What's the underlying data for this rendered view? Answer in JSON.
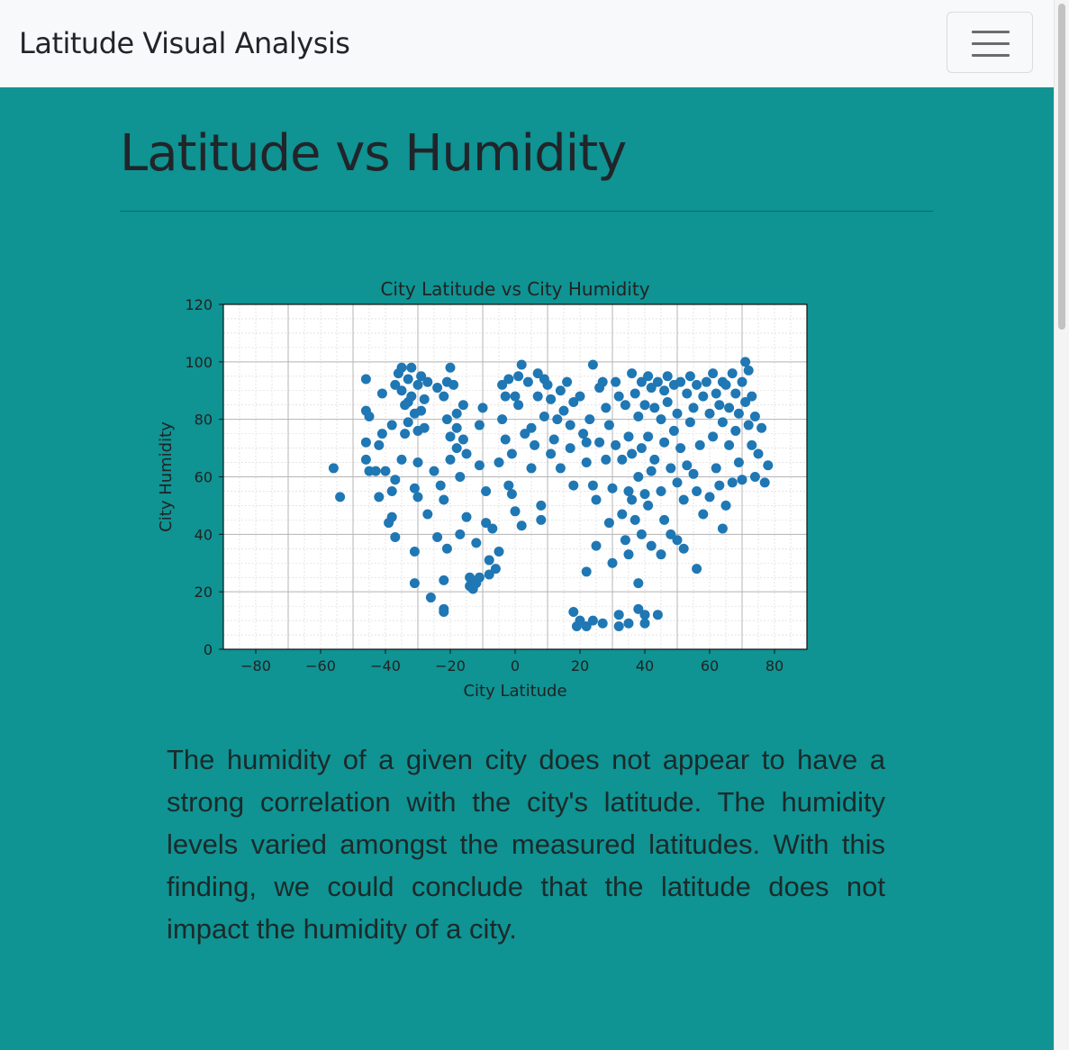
{
  "navbar": {
    "brand": "Latitude Visual Analysis",
    "toggler_icon": "hamburger-menu-icon"
  },
  "main": {
    "title": "Latitude vs Humidity",
    "description": "The humidity of a given city does not appear to have a strong correlation with the city's latitude. The humidity levels varied amongst the measured latitudes. With this finding, we could conclude that the latitude does not impact the humidity of a city."
  },
  "colors": {
    "background": "#0f9393",
    "navbar": "#f8f9fa",
    "point": "#1f77b4"
  },
  "chart_data": {
    "type": "scatter",
    "title": "City Latitude vs City Humidity",
    "xlabel": "City Latitude",
    "ylabel": "City Humidity",
    "xlim": [
      -90,
      90
    ],
    "ylim": [
      0,
      120
    ],
    "xticks": [
      -80,
      -60,
      -40,
      -20,
      0,
      20,
      40,
      60,
      80
    ],
    "yticks": [
      0,
      20,
      40,
      60,
      80,
      100,
      120
    ],
    "x_tick_labels": [
      "−80",
      "−60",
      "−40",
      "−20",
      "0",
      "20",
      "40",
      "60",
      "80"
    ],
    "y_tick_labels": [
      "0",
      "20",
      "40",
      "60",
      "80",
      "100",
      "120"
    ],
    "grid": true,
    "series": [
      {
        "points": [
          [
            -56,
            63
          ],
          [
            -54,
            53
          ],
          [
            -46,
            94
          ],
          [
            -46,
            83
          ],
          [
            -45,
            81
          ],
          [
            -46,
            72
          ],
          [
            -46,
            66
          ],
          [
            -45,
            62
          ],
          [
            -43,
            62
          ],
          [
            -42,
            53
          ],
          [
            -42,
            71
          ],
          [
            -41,
            75
          ],
          [
            -41,
            89
          ],
          [
            -40,
            62
          ],
          [
            -39,
            44
          ],
          [
            -38,
            46
          ],
          [
            -37,
            39
          ],
          [
            -37,
            59
          ],
          [
            -38,
            55
          ],
          [
            -38,
            78
          ],
          [
            -37,
            92
          ],
          [
            -36,
            96
          ],
          [
            -35,
            98
          ],
          [
            -35,
            90
          ],
          [
            -34,
            85
          ],
          [
            -33,
            94
          ],
          [
            -33,
            79
          ],
          [
            -34,
            75
          ],
          [
            -35,
            66
          ],
          [
            -33,
            86
          ],
          [
            -32,
            98
          ],
          [
            -32,
            88
          ],
          [
            -31,
            82
          ],
          [
            -30,
            92
          ],
          [
            -30,
            76
          ],
          [
            -30,
            65
          ],
          [
            -29,
            95
          ],
          [
            -29,
            83
          ],
          [
            -28,
            87
          ],
          [
            -28,
            77
          ],
          [
            -27,
            93
          ],
          [
            -31,
            56
          ],
          [
            -30,
            53
          ],
          [
            -31,
            34
          ],
          [
            -31,
            23
          ],
          [
            -27,
            47
          ],
          [
            -26,
            18
          ],
          [
            -25,
            62
          ],
          [
            -24,
            39
          ],
          [
            -23,
            57
          ],
          [
            -22,
            52
          ],
          [
            -22,
            14
          ],
          [
            -22,
            13
          ],
          [
            -22,
            24
          ],
          [
            -21,
            35
          ],
          [
            -24,
            91
          ],
          [
            -22,
            88
          ],
          [
            -21,
            93
          ],
          [
            -20,
            98
          ],
          [
            -21,
            80
          ],
          [
            -20,
            74
          ],
          [
            -20,
            66
          ],
          [
            -19,
            92
          ],
          [
            -18,
            82
          ],
          [
            -18,
            77
          ],
          [
            -18,
            70
          ],
          [
            -17,
            60
          ],
          [
            -17,
            40
          ],
          [
            -16,
            85
          ],
          [
            -16,
            73
          ],
          [
            -15,
            68
          ],
          [
            -15,
            46
          ],
          [
            -14,
            22
          ],
          [
            -14,
            25
          ],
          [
            -13,
            21
          ],
          [
            -12,
            23
          ],
          [
            -12,
            37
          ],
          [
            -11,
            25
          ],
          [
            -11,
            64
          ],
          [
            -11,
            78
          ],
          [
            -10,
            84
          ],
          [
            -9,
            55
          ],
          [
            -9,
            44
          ],
          [
            -8,
            31
          ],
          [
            -8,
            26
          ],
          [
            -7,
            42
          ],
          [
            -6,
            28
          ],
          [
            -5,
            34
          ],
          [
            -5,
            65
          ],
          [
            -4,
            92
          ],
          [
            -4,
            80
          ],
          [
            -3,
            88
          ],
          [
            -3,
            73
          ],
          [
            -2,
            94
          ],
          [
            -2,
            57
          ],
          [
            -1,
            54
          ],
          [
            -1,
            68
          ],
          [
            0,
            88
          ],
          [
            0,
            48
          ],
          [
            1,
            95
          ],
          [
            2,
            99
          ],
          [
            1,
            85
          ],
          [
            2,
            43
          ],
          [
            3,
            75
          ],
          [
            4,
            93
          ],
          [
            5,
            77
          ],
          [
            5,
            63
          ],
          [
            6,
            71
          ],
          [
            7,
            96
          ],
          [
            7,
            88
          ],
          [
            8,
            50
          ],
          [
            8,
            45
          ],
          [
            9,
            81
          ],
          [
            9,
            94
          ],
          [
            10,
            92
          ],
          [
            11,
            87
          ],
          [
            11,
            68
          ],
          [
            12,
            73
          ],
          [
            13,
            80
          ],
          [
            14,
            90
          ],
          [
            14,
            63
          ],
          [
            15,
            83
          ],
          [
            16,
            93
          ],
          [
            17,
            70
          ],
          [
            17,
            78
          ],
          [
            18,
            86
          ],
          [
            18,
            57
          ],
          [
            18,
            13
          ],
          [
            19,
            8
          ],
          [
            20,
            10
          ],
          [
            20,
            88
          ],
          [
            21,
            75
          ],
          [
            22,
            72
          ],
          [
            22,
            65
          ],
          [
            22,
            27
          ],
          [
            22,
            8
          ],
          [
            23,
            80
          ],
          [
            24,
            99
          ],
          [
            24,
            10
          ],
          [
            24,
            57
          ],
          [
            25,
            36
          ],
          [
            25,
            52
          ],
          [
            26,
            72
          ],
          [
            26,
            91
          ],
          [
            27,
            93
          ],
          [
            27,
            9
          ],
          [
            28,
            84
          ],
          [
            28,
            66
          ],
          [
            29,
            78
          ],
          [
            29,
            44
          ],
          [
            30,
            30
          ],
          [
            30,
            56
          ],
          [
            31,
            93
          ],
          [
            31,
            71
          ],
          [
            32,
            88
          ],
          [
            32,
            8
          ],
          [
            32,
            12
          ],
          [
            33,
            66
          ],
          [
            33,
            47
          ],
          [
            34,
            38
          ],
          [
            34,
            85
          ],
          [
            35,
            55
          ],
          [
            35,
            33
          ],
          [
            35,
            74
          ],
          [
            35,
            9
          ],
          [
            36,
            96
          ],
          [
            36,
            68
          ],
          [
            36,
            52
          ],
          [
            37,
            89
          ],
          [
            37,
            45
          ],
          [
            38,
            81
          ],
          [
            38,
            60
          ],
          [
            38,
            23
          ],
          [
            38,
            14
          ],
          [
            39,
            93
          ],
          [
            39,
            70
          ],
          [
            39,
            40
          ],
          [
            40,
            85
          ],
          [
            40,
            54
          ],
          [
            40,
            12
          ],
          [
            40,
            9
          ],
          [
            41,
            95
          ],
          [
            41,
            74
          ],
          [
            41,
            50
          ],
          [
            42,
            91
          ],
          [
            42,
            62
          ],
          [
            42,
            36
          ],
          [
            43,
            84
          ],
          [
            43,
            66
          ],
          [
            44,
            93
          ],
          [
            44,
            12
          ],
          [
            45,
            80
          ],
          [
            45,
            55
          ],
          [
            45,
            33
          ],
          [
            46,
            90
          ],
          [
            46,
            72
          ],
          [
            46,
            45
          ],
          [
            47,
            95
          ],
          [
            47,
            86
          ],
          [
            48,
            63
          ],
          [
            48,
            40
          ],
          [
            49,
            92
          ],
          [
            49,
            76
          ],
          [
            50,
            82
          ],
          [
            50,
            58
          ],
          [
            50,
            38
          ],
          [
            51,
            93
          ],
          [
            51,
            70
          ],
          [
            52,
            52
          ],
          [
            52,
            35
          ],
          [
            53,
            89
          ],
          [
            53,
            64
          ],
          [
            54,
            95
          ],
          [
            54,
            79
          ],
          [
            55,
            84
          ],
          [
            55,
            61
          ],
          [
            56,
            92
          ],
          [
            56,
            55
          ],
          [
            56,
            28
          ],
          [
            57,
            71
          ],
          [
            58,
            88
          ],
          [
            58,
            47
          ],
          [
            59,
            93
          ],
          [
            60,
            82
          ],
          [
            60,
            53
          ],
          [
            61,
            96
          ],
          [
            61,
            74
          ],
          [
            62,
            89
          ],
          [
            62,
            63
          ],
          [
            63,
            85
          ],
          [
            63,
            57
          ],
          [
            64,
            93
          ],
          [
            64,
            79
          ],
          [
            64,
            42
          ],
          [
            65,
            92
          ],
          [
            65,
            50
          ],
          [
            66,
            84
          ],
          [
            66,
            71
          ],
          [
            67,
            96
          ],
          [
            67,
            58
          ],
          [
            68,
            89
          ],
          [
            68,
            76
          ],
          [
            69,
            82
          ],
          [
            69,
            65
          ],
          [
            70,
            93
          ],
          [
            70,
            59
          ],
          [
            71,
            100
          ],
          [
            71,
            86
          ],
          [
            72,
            78
          ],
          [
            72,
            97
          ],
          [
            73,
            88
          ],
          [
            73,
            71
          ],
          [
            74,
            81
          ],
          [
            74,
            60
          ],
          [
            75,
            68
          ],
          [
            76,
            77
          ],
          [
            77,
            58
          ],
          [
            78,
            64
          ]
        ]
      }
    ]
  }
}
